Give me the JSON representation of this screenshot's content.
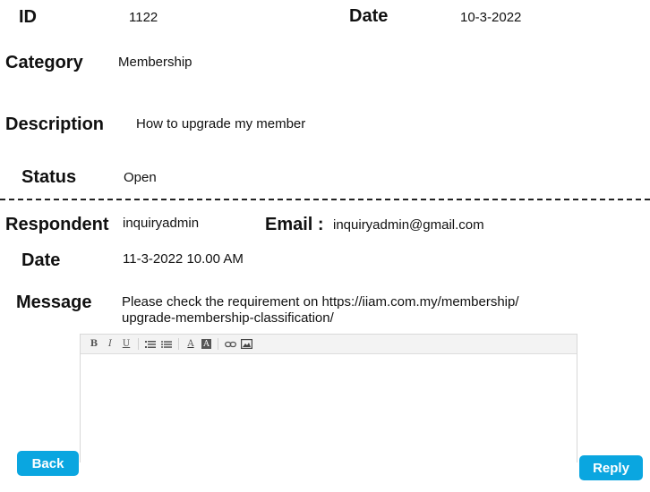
{
  "ticket": {
    "id_label": "ID",
    "id_value": "1122",
    "date_label": "Date",
    "date_value": "10-3-2022",
    "category_label": "Category",
    "category_value": "Membership",
    "description_label": "Description",
    "description_value": "How to upgrade my member",
    "status_label": "Status",
    "status_value": "Open"
  },
  "response": {
    "respondent_label": "Respondent",
    "respondent_value": "inquiryadmin",
    "email_label": "Email :",
    "email_value": "inquiryadmin@gmail.com",
    "date_label": "Date",
    "date_value": "11-3-2022 10.00 AM",
    "message_label": "Message",
    "message_line1": "Please check the requirement on https://iiam.com.my/membership/",
    "message_line2": "upgrade-membership-classification/"
  },
  "editor": {
    "bold": "B",
    "italic": "I",
    "underline": "U",
    "font_color": "A",
    "background_color": "A",
    "value": ""
  },
  "buttons": {
    "back": "Back",
    "reply": "Reply"
  },
  "colors": {
    "accent": "#0aa6e0"
  }
}
